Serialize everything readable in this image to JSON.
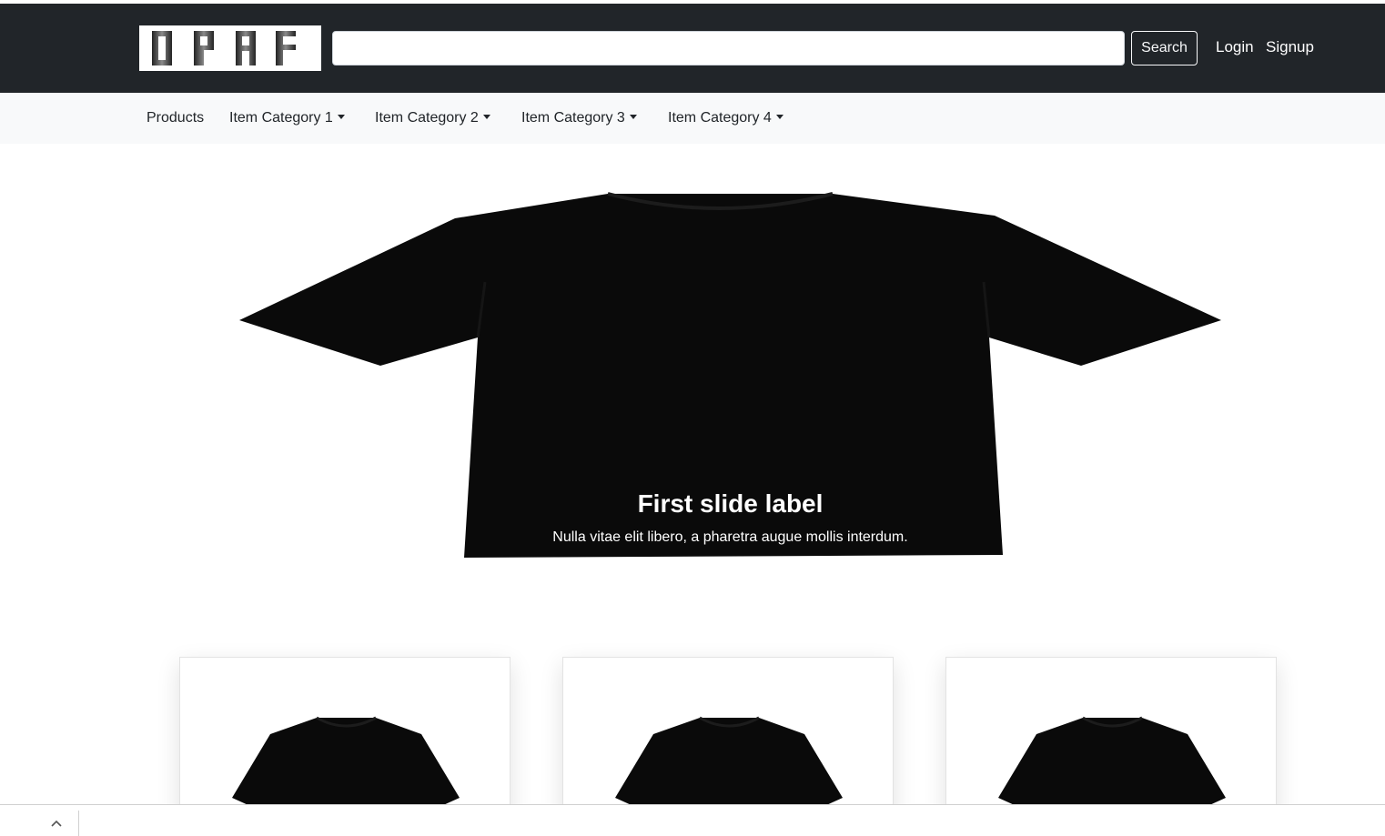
{
  "header": {
    "logo_text": "DRAF",
    "search": {
      "value": "",
      "placeholder": ""
    },
    "search_button": "Search",
    "login": "Login",
    "signup": "Signup"
  },
  "nav": {
    "products": "Products",
    "categories": [
      "Item Category 1",
      "Item Category 2",
      "Item Category 3",
      "Item Category 4"
    ]
  },
  "carousel": {
    "title": "First slide label",
    "caption": "Nulla vitae elit libero, a pharetra augue mollis interdum."
  },
  "bottom_bar": {
    "toggle_icon": "chevron-up-icon"
  },
  "colors": {
    "header_bg": "#212529",
    "nav_bg": "#f8f9fa",
    "shirt": "#0a0a0a"
  }
}
